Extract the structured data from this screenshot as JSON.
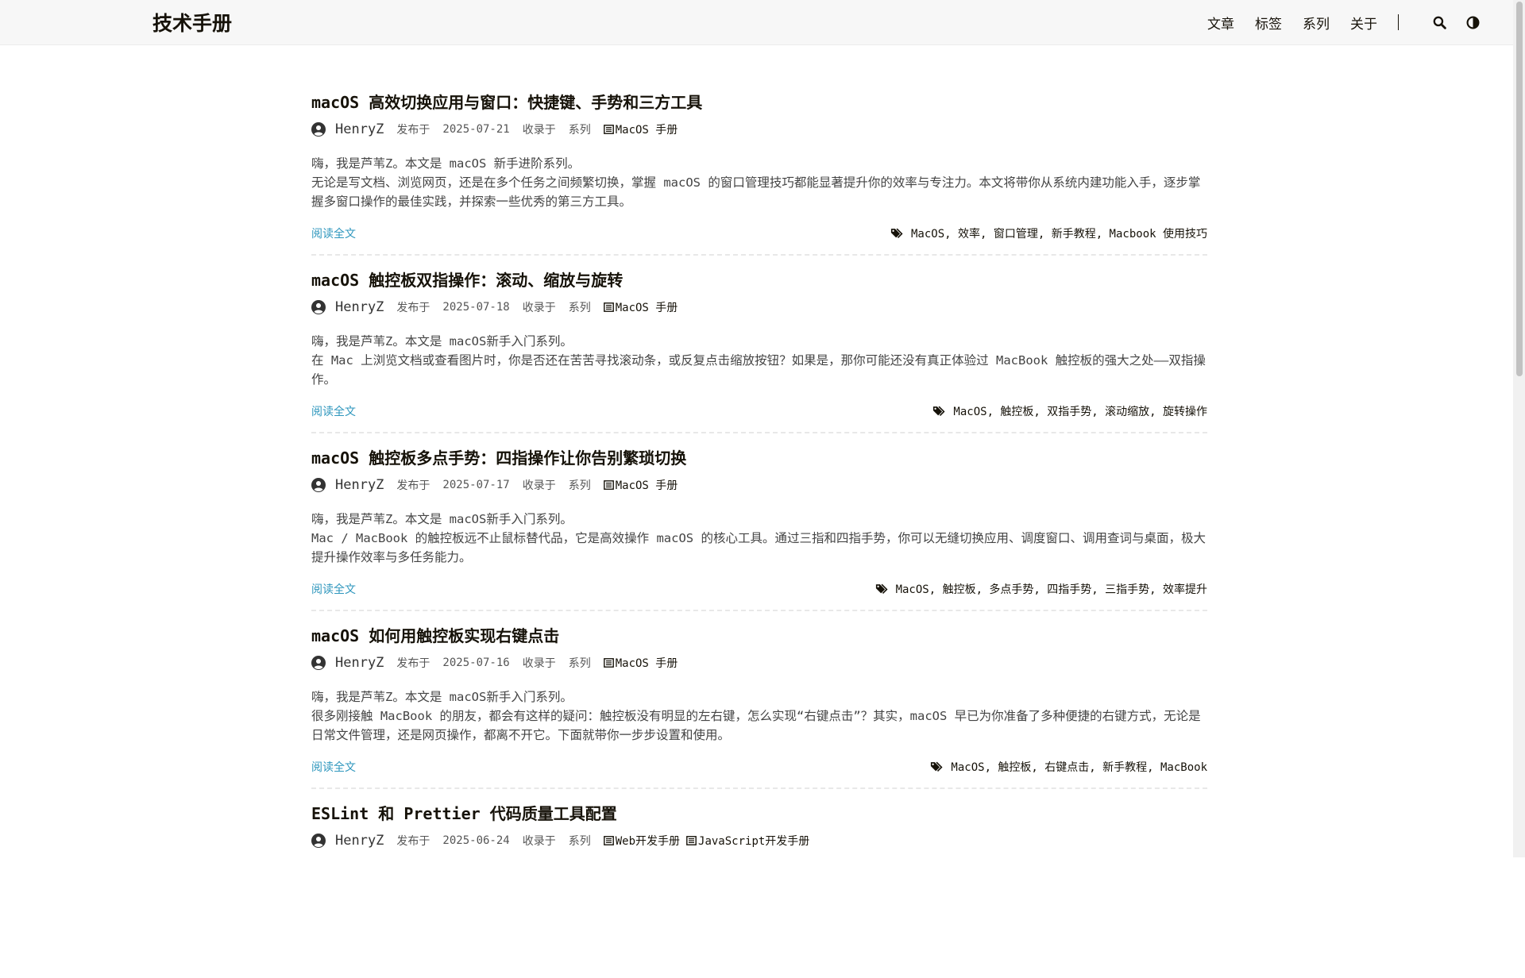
{
  "site": {
    "title": "技术手册"
  },
  "nav": {
    "items": [
      "文章",
      "标签",
      "系列",
      "关于"
    ],
    "search_icon": "search-icon",
    "theme_icon": "theme-toggle-icon"
  },
  "labels": {
    "published": "发布于",
    "collected": "收录于",
    "series": "系列",
    "read_more": "阅读全文"
  },
  "posts": [
    {
      "title": "macOS 高效切换应用与窗口：快捷键、手势和三方工具",
      "author": "HenryZ",
      "date": "2025-07-21",
      "series": [
        "MacOS 手册"
      ],
      "excerpt": [
        "嗨，我是芦苇Z。本文是 macOS 新手进阶系列。",
        "无论是写文档、浏览网页，还是在多个任务之间频繁切换，掌握 macOS 的窗口管理技巧都能显著提升你的效率与专注力。本文将带你从系统内建功能入手，逐步掌握多窗口操作的最佳实践，并探索一些优秀的第三方工具。"
      ],
      "tags": "MacOS, 效率, 窗口管理, 新手教程, Macbook 使用技巧"
    },
    {
      "title": "macOS 触控板双指操作：滚动、缩放与旋转",
      "author": "HenryZ",
      "date": "2025-07-18",
      "series": [
        "MacOS 手册"
      ],
      "excerpt": [
        "嗨，我是芦苇Z。本文是 macOS新手入门系列。",
        "在 Mac 上浏览文档或查看图片时，你是否还在苦苦寻找滚动条，或反复点击缩放按钮？如果是，那你可能还没有真正体验过 MacBook 触控板的强大之处——双指操作。"
      ],
      "tags": "MacOS, 触控板, 双指手势, 滚动缩放, 旋转操作"
    },
    {
      "title": "macOS 触控板多点手势：四指操作让你告别繁琐切换",
      "author": "HenryZ",
      "date": "2025-07-17",
      "series": [
        "MacOS 手册"
      ],
      "excerpt": [
        "嗨，我是芦苇Z。本文是 macOS新手入门系列。",
        "Mac / MacBook 的触控板远不止鼠标替代品，它是高效操作 macOS 的核心工具。通过三指和四指手势，你可以无缝切换应用、调度窗口、调用查词与桌面，极大提升操作效率与多任务能力。"
      ],
      "tags": "MacOS, 触控板, 多点手势, 四指手势, 三指手势, 效率提升"
    },
    {
      "title": "macOS 如何用触控板实现右键点击",
      "author": "HenryZ",
      "date": "2025-07-16",
      "series": [
        "MacOS 手册"
      ],
      "excerpt": [
        "嗨，我是芦苇Z。本文是 macOS新手入门系列。",
        "很多刚接触 MacBook 的朋友，都会有这样的疑问：触控板没有明显的左右键，怎么实现“右键点击”？其实，macOS 早已为你准备了多种便捷的右键方式，无论是日常文件管理，还是网页操作，都离不开它。下面就带你一步步设置和使用。"
      ],
      "tags": "MacOS, 触控板, 右键点击, 新手教程, MacBook"
    },
    {
      "title": "ESLint 和 Prettier 代码质量工具配置",
      "author": "HenryZ",
      "date": "2025-06-24",
      "series": [
        "Web开发手册",
        "JavaScript开发手册"
      ],
      "excerpt": [],
      "tags": ""
    }
  ]
}
